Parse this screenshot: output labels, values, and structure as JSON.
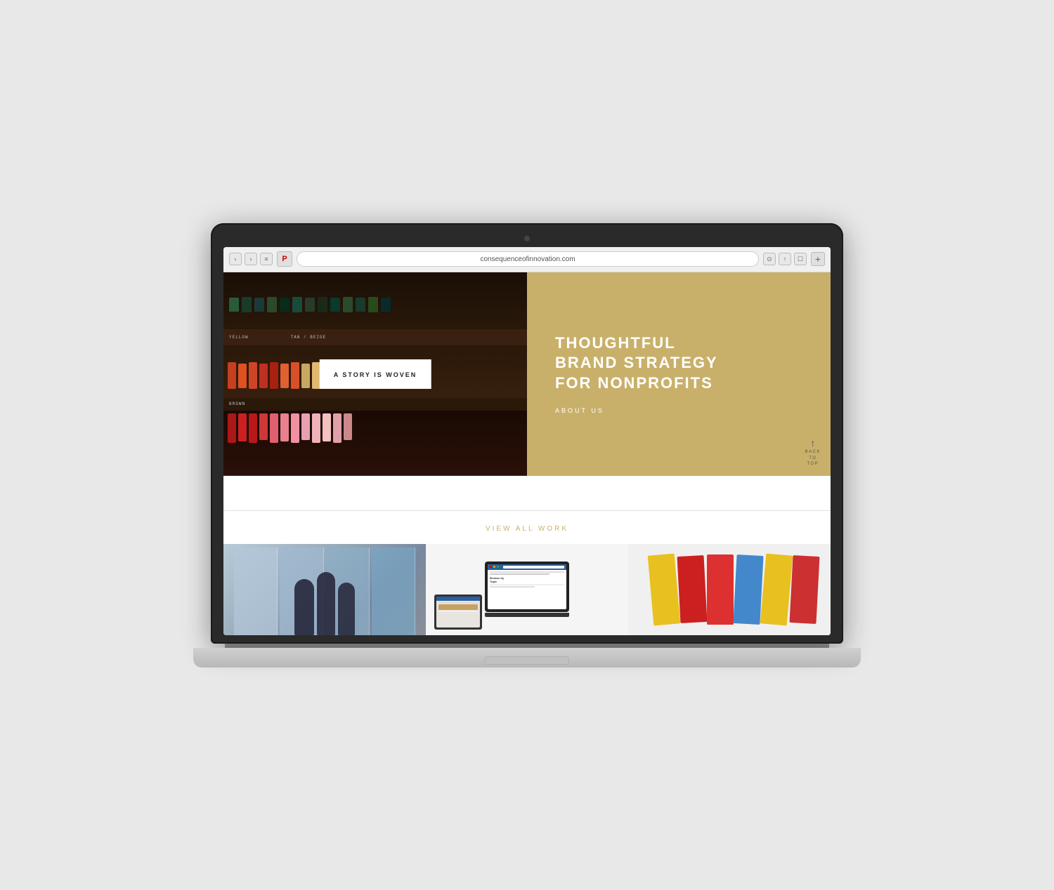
{
  "laptop": {
    "browser": {
      "url": "consequenceofinnovation.com",
      "back_btn": "‹",
      "forward_btn": "›",
      "reader_btn": "≡",
      "pinterest_btn": "P",
      "refresh_icon": "↻",
      "action_btn": "↑",
      "share_btn": "□",
      "new_tab_btn": "+"
    },
    "website": {
      "hero": {
        "story_box_text": "A STORY IS WOVEN",
        "brand_heading_line1": "THOUGHTFUL",
        "brand_heading_line2": "BRAND STRATEGY",
        "brand_heading_line3": "FOR NONPROFITS",
        "about_us_label": "ABOUT US",
        "back_to_top_label": "BACK\nTO\nTOP",
        "shelf_label_yellow": "YELLOW",
        "shelf_label_tan": "TAN / BEIGE",
        "shelf_label_brown": "BROWN"
      },
      "portfolio": {
        "view_all_label": "VIEW ALL WORK",
        "browse_by_topic": "Browse by\nTopic"
      }
    }
  },
  "colors": {
    "brand_gold": "#c9b06a",
    "brand_white": "#ffffff",
    "dark_wood": "#3a2010",
    "thread_bg": "#2a1808"
  }
}
